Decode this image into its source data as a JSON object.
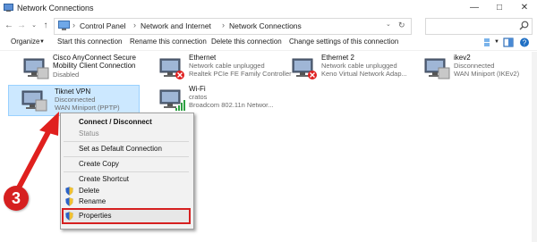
{
  "window": {
    "title": "Network Connections"
  },
  "address": {
    "crumbs": [
      "Control Panel",
      "Network and Internet",
      "Network Connections"
    ]
  },
  "search": {
    "placeholder": ""
  },
  "toolbar": {
    "items": [
      "Organize",
      "Start this connection",
      "Rename this connection",
      "Delete this connection",
      "Change settings of this connection"
    ]
  },
  "connections": [
    {
      "name": "Cisco AnyConnect Secure",
      "name2": "Mobility Client Connection",
      "status": "Disabled",
      "device": ""
    },
    {
      "name": "Ethernet",
      "status": "Network cable unplugged",
      "device": "Realtek PCIe FE Family Controller"
    },
    {
      "name": "Ethernet 2",
      "status": "Network cable unplugged",
      "device": "Keno Virtual Network Adap..."
    },
    {
      "name": "ikev2",
      "status": "Disconnected",
      "device": "WAN Miniport (IKEv2)"
    },
    {
      "name": "Tiknet VPN",
      "status": "Disconnected",
      "device": "WAN Miniport (PPTP)"
    },
    {
      "name": "Wi-Fi",
      "status": "cratos",
      "device": "Broadcom 802.11n Networ..."
    }
  ],
  "context_menu": {
    "items": [
      "Connect / Disconnect",
      "Status",
      "Set as Default Connection",
      "Create Copy",
      "Create Shortcut",
      "Delete",
      "Rename",
      "Properties"
    ]
  },
  "annotation": {
    "step": "3",
    "arrow_color": "#e0201e"
  }
}
